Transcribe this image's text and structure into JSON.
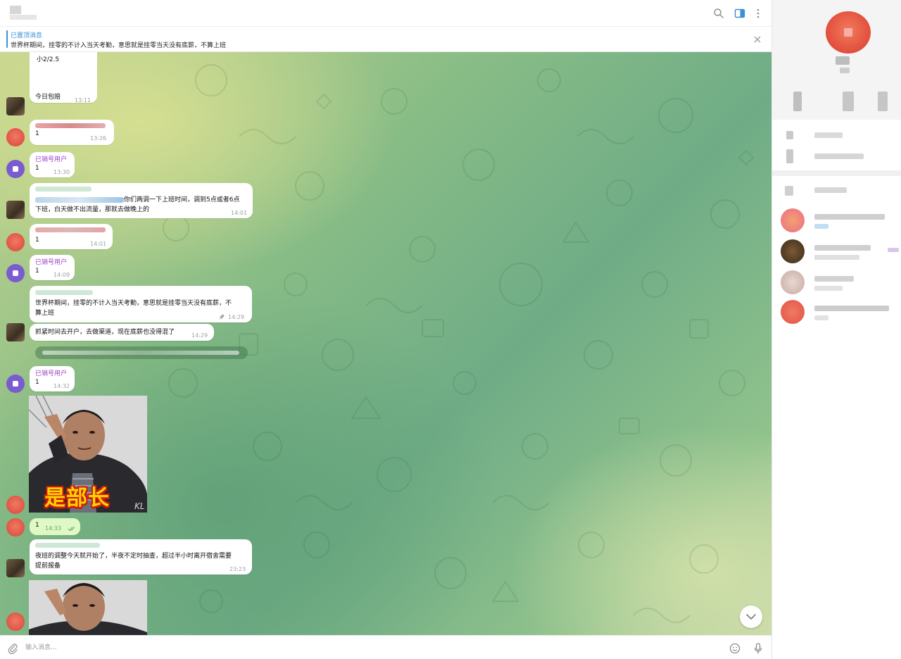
{
  "header": {
    "title": "",
    "icons": [
      "search-icon",
      "sidebar-toggle-icon",
      "more-vertical-icon"
    ]
  },
  "pinned": {
    "label": "已置顶消息",
    "text": "世界杯期间，挂零的不计入当天考勤，意思就是挂零当天没有底薪，不算上班"
  },
  "messages": [
    {
      "text1": "小2/2.5",
      "text2": "今日包赔",
      "time": "13:11"
    },
    {
      "text": "1",
      "time": "13:26"
    },
    {
      "sender": "已销号用户",
      "text": "1",
      "time": "13:30"
    },
    {
      "text": "你们两调一下上班时间，调到5点或者6点",
      "text_cont": "下班，白天做不出流量，那就去做晚上的",
      "time": "14:01"
    },
    {
      "text": "1",
      "time": "14:01"
    },
    {
      "sender": "已销号用户",
      "text": "1",
      "time": "14:09"
    },
    {
      "text": "世界杯期间，挂零的不计入当天考勤，意思就是挂零当天没有底薪，不",
      "text_cont": "算上班",
      "time": "14:29"
    },
    {
      "text": "抓紧时间去开户，去做渠道，现在底薪也没得混了",
      "time": "14:29"
    },
    {
      "sender": "已销号用户",
      "text": "1",
      "time": "14:32"
    },
    {
      "caption": "是部长",
      "watermark": "KL"
    },
    {
      "text": "1",
      "time": "14:33",
      "outgoing": true
    },
    {
      "text": "夜班的调整今天就开始了，半夜不定时抽查，超过半小时离开宿舍需要",
      "text_cont": "提前报备",
      "time": "23:23"
    }
  ],
  "input": {
    "placeholder": "输入消息..."
  },
  "colors": {
    "accent": "#3a8fd9",
    "sender": "#9c3fc6",
    "outgoing_bubble": "#e0f8c6",
    "avatar_red": "#e05446",
    "avatar_purple": "#7a5bd0"
  }
}
